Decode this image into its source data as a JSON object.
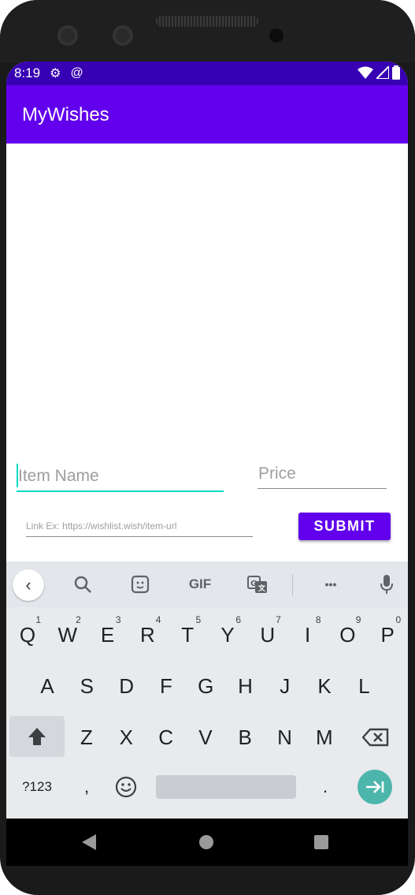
{
  "status": {
    "time": "8:19",
    "settings_icon": "gear-icon",
    "sync_icon": "at-icon"
  },
  "appbar": {
    "title": "MyWishes"
  },
  "form": {
    "item_name_placeholder": "Item Name",
    "price_placeholder": "Price",
    "link_placeholder": "Link Ex: https://wishlist.wish/item-url",
    "submit_label": "SUBMIT"
  },
  "keyboard": {
    "toolbar": {
      "gif_label": "GIF",
      "more_label": "•••"
    },
    "row1": [
      {
        "k": "Q",
        "n": "1"
      },
      {
        "k": "W",
        "n": "2"
      },
      {
        "k": "E",
        "n": "3"
      },
      {
        "k": "R",
        "n": "4"
      },
      {
        "k": "T",
        "n": "5"
      },
      {
        "k": "Y",
        "n": "6"
      },
      {
        "k": "U",
        "n": "7"
      },
      {
        "k": "I",
        "n": "8"
      },
      {
        "k": "O",
        "n": "9"
      },
      {
        "k": "P",
        "n": "0"
      }
    ],
    "row2": [
      "A",
      "S",
      "D",
      "F",
      "G",
      "H",
      "J",
      "K",
      "L"
    ],
    "row3": [
      "Z",
      "X",
      "C",
      "V",
      "B",
      "N",
      "M"
    ],
    "symbols_label": "?123",
    "comma_label": ",",
    "period_label": "."
  }
}
